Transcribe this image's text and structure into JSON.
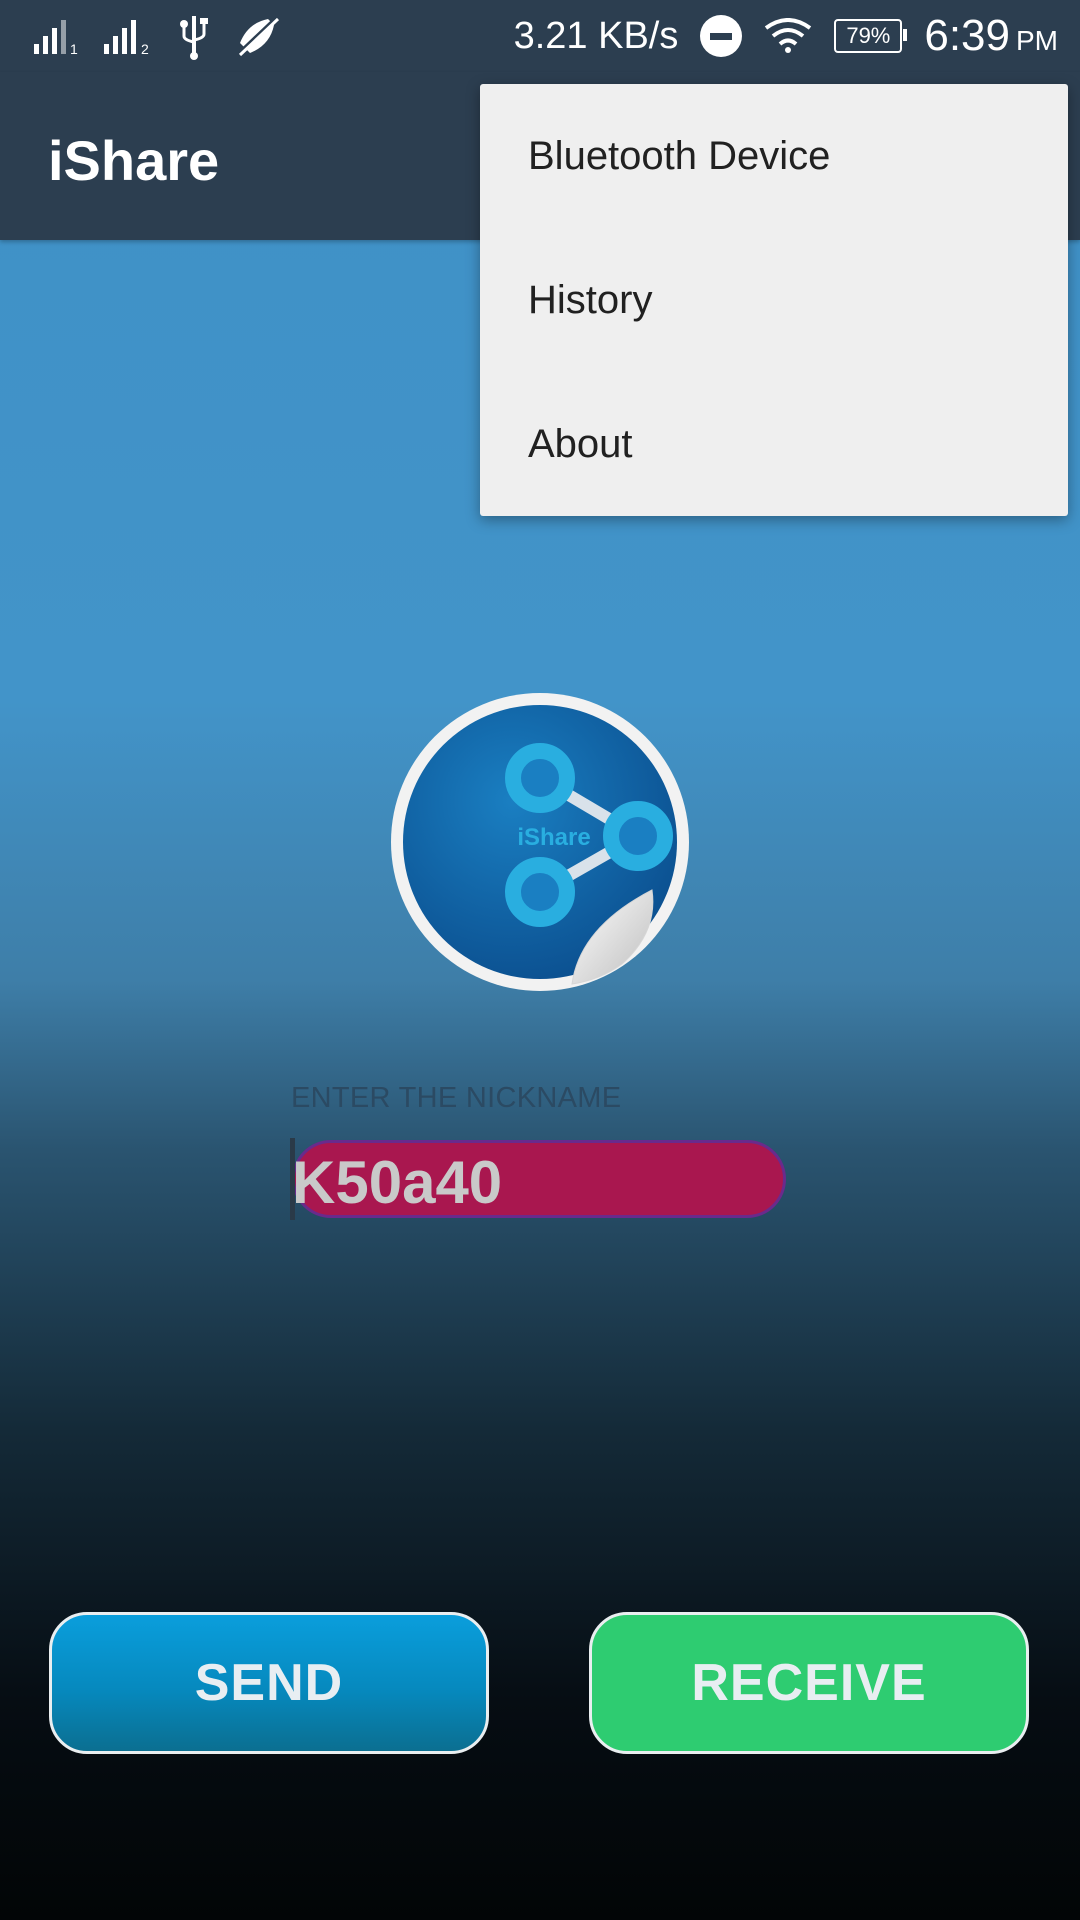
{
  "status_bar": {
    "net_speed": "3.21 KB/s",
    "battery": "79%",
    "time": "6:39",
    "ampm": "PM",
    "icons": [
      "signal-sim1-icon",
      "signal-sim2-icon",
      "usb-icon",
      "mute-icon",
      "dnd-icon",
      "wifi-icon",
      "battery-icon"
    ]
  },
  "app_bar": {
    "title": "iShare"
  },
  "menu": {
    "items": [
      {
        "label": "Bluetooth Device"
      },
      {
        "label": "History"
      },
      {
        "label": "About"
      }
    ]
  },
  "logo": {
    "text": "iShare",
    "icon": "share-icon"
  },
  "nickname": {
    "label": "ENTER THE NICKNAME",
    "value": "K50a40"
  },
  "actions": {
    "send_label": "SEND",
    "receive_label": "RECEIVE"
  },
  "colors": {
    "app_bar": "#2c3e50",
    "menu_bg": "#efefef",
    "nickname_field": "#a9174f",
    "send_button": "#0689be",
    "receive_button": "#2ecc71"
  }
}
